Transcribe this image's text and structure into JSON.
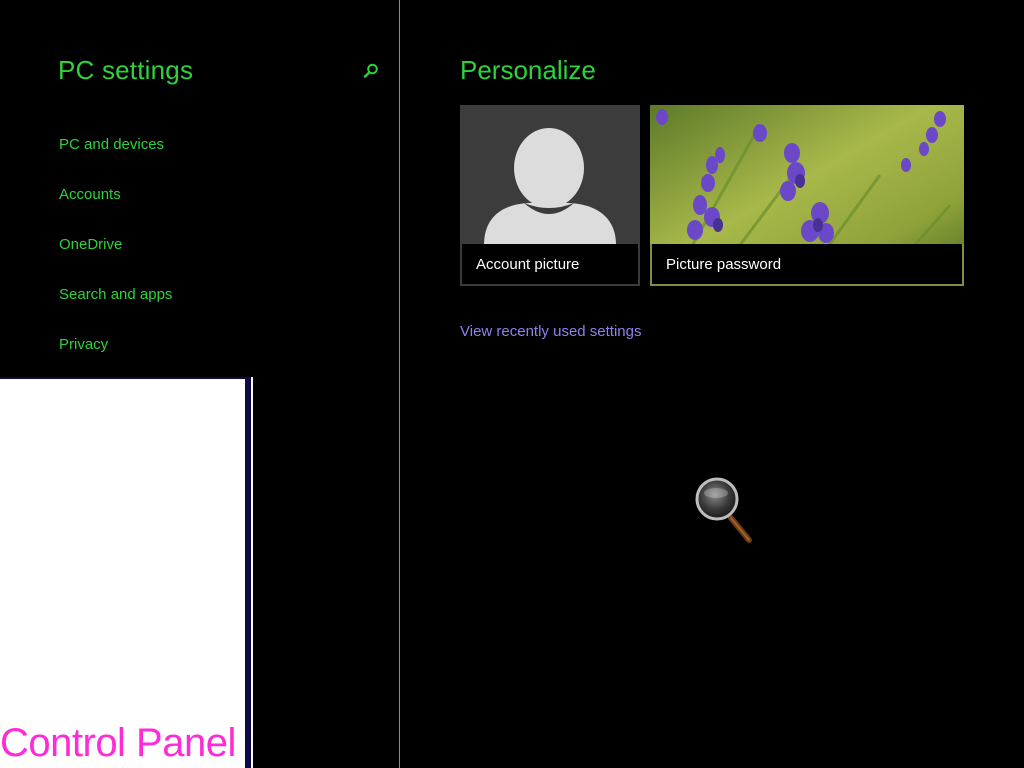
{
  "app": {
    "title": "PC settings"
  },
  "sidebar": {
    "items": [
      {
        "label": "PC and devices"
      },
      {
        "label": "Accounts"
      },
      {
        "label": "OneDrive"
      },
      {
        "label": "Search and apps"
      },
      {
        "label": "Privacy"
      }
    ],
    "search_icon": "search-icon"
  },
  "control_panel_tile": {
    "label": "Control Panel"
  },
  "main": {
    "title": "Personalize",
    "tiles": [
      {
        "label": "Account picture",
        "icon": "user-silhouette-icon"
      },
      {
        "label": "Picture password",
        "image": "lavender-flowers-photo"
      }
    ],
    "recent_link": "View recently used settings"
  },
  "overlay": {
    "magnifier_icon": "magnifier-icon"
  },
  "colors": {
    "accent_green": "#2ed23a",
    "link_purple": "#8a84ee",
    "control_panel_pink": "#ff2bd6",
    "background": "#000000"
  }
}
